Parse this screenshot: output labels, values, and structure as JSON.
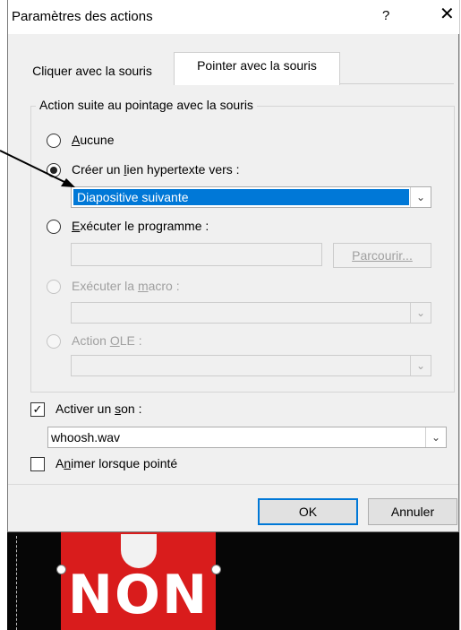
{
  "window": {
    "title": "Paramètres des actions",
    "help_label": "?",
    "close_label": "✕"
  },
  "tabs": [
    {
      "label": "Cliquer avec la souris",
      "active": false
    },
    {
      "label": "Pointer avec la souris",
      "active": true
    }
  ],
  "group": {
    "legend": "Action suite au pointage avec la souris",
    "options": {
      "none": {
        "label": "Aucune",
        "checked": false,
        "enabled": true
      },
      "hyperlink": {
        "label": "Créer un lien hypertexte vers :",
        "checked": true,
        "enabled": true
      },
      "program": {
        "label": "Exécuter le programme :",
        "checked": false,
        "enabled": true
      },
      "macro": {
        "label": "Exécuter la macro :",
        "checked": false,
        "enabled": false
      },
      "ole": {
        "label": "Action OLE :",
        "checked": false,
        "enabled": false
      }
    },
    "hyperlink_select": {
      "value": "Diapositive suivante"
    },
    "program_input": {
      "value": ""
    },
    "browse_label": "Parcourir...",
    "macro_select": {
      "value": ""
    },
    "ole_select": {
      "value": ""
    }
  },
  "sound": {
    "label": "Activer un son :",
    "checked": true,
    "value": "whoosh.wav"
  },
  "highlight": {
    "label": "Animer lorsque pointé",
    "checked": false
  },
  "buttons": {
    "ok": "OK",
    "cancel": "Annuler"
  },
  "slide": {
    "sign_text": "NON",
    "sign_color": "#d91c1c"
  },
  "colors": {
    "selection": "#0078d7",
    "dialog_bg": "#f0f0f0"
  },
  "icons": {
    "dropdown": "chevron-down-icon",
    "checkmark": "checkmark-icon"
  }
}
